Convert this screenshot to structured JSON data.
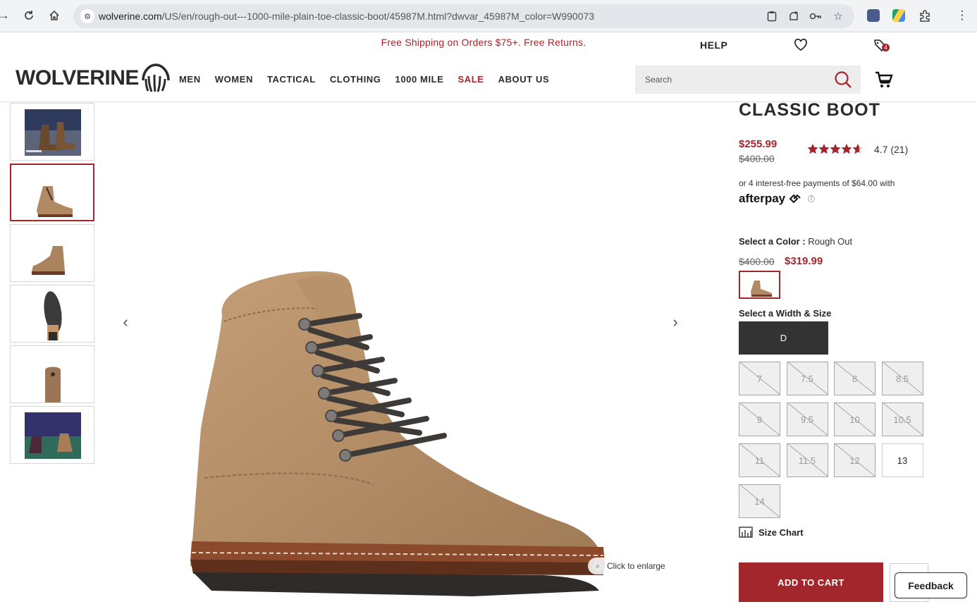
{
  "browser": {
    "url_host": "wolverine.com",
    "url_path": "/US/en/rough-out---1000-mile-plain-toe-classic-boot/45987M.html?dwvar_45987M_color=W990073"
  },
  "header": {
    "promo": "Free Shipping on Orders $75+. Free Returns.",
    "help": "HELP",
    "wishlist_count": "4",
    "logo_text": "WOLVERINE",
    "nav": [
      "MEN",
      "WOMEN",
      "TACTICAL",
      "CLOTHING",
      "1000 MILE",
      "SALE",
      "ABOUT US"
    ],
    "search_placeholder": "Search"
  },
  "gallery": {
    "thumbnail_count": 6,
    "active_thumbnail": 2,
    "enlarge_label": "Click to enlarge"
  },
  "product": {
    "title": "CLASSIC BOOT",
    "sale_price": "$255.99",
    "original_price": "$400.00",
    "rating_value": 4.7,
    "rating_text": "4.7 (21)",
    "afterpay_text": "or 4 interest-free payments of $64.00 with",
    "afterpay_brand": "afterpay",
    "color_label": "Select a Color :",
    "color_value": "Rough Out",
    "color_original_price": "$400.00",
    "color_sale_price": "$319.99",
    "size_label": "Select a Width & Size",
    "width": "D",
    "sizes": [
      {
        "label": "7",
        "available": false
      },
      {
        "label": "7.5",
        "available": false
      },
      {
        "label": "8",
        "available": false
      },
      {
        "label": "8.5",
        "available": false
      },
      {
        "label": "9",
        "available": false
      },
      {
        "label": "9.5",
        "available": false
      },
      {
        "label": "10",
        "available": false
      },
      {
        "label": "10.5",
        "available": false
      },
      {
        "label": "11",
        "available": false
      },
      {
        "label": "11.5",
        "available": false
      },
      {
        "label": "12",
        "available": false
      },
      {
        "label": "13",
        "available": true
      },
      {
        "label": "14",
        "available": false
      }
    ],
    "size_chart": "Size Chart",
    "add_to_cart": "ADD TO CART"
  },
  "feedback": "Feedback",
  "colors": {
    "brand_red": "#a3262c",
    "dark": "#333333"
  }
}
